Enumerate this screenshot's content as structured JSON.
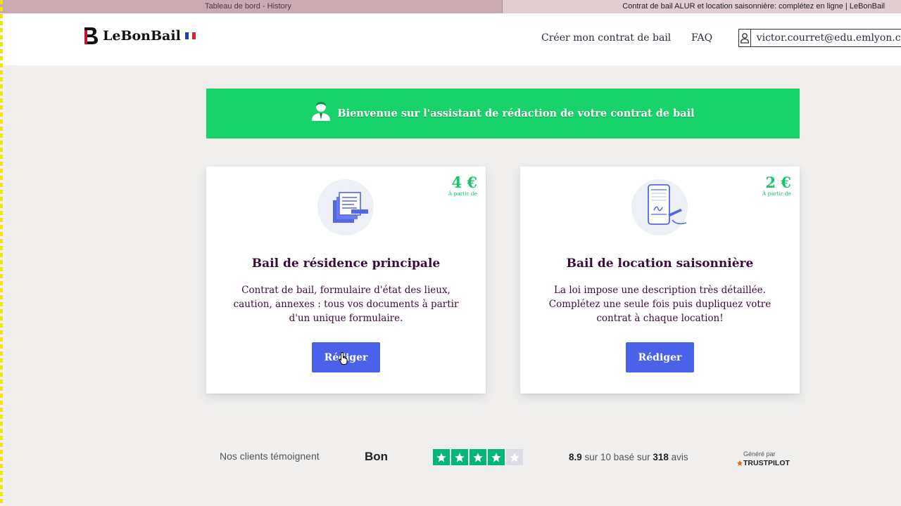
{
  "browser": {
    "tabs": [
      {
        "title": "Tableau de bord - History",
        "active": false
      },
      {
        "title": "Contrat de bail ALUR et location saisonnière: complétez en ligne | LeBonBail",
        "active": true
      }
    ]
  },
  "header": {
    "logo_text": "LeBonBail",
    "logo_mark": "B",
    "nav": {
      "create_contract": "Créer mon contrat de bail",
      "faq": "FAQ"
    },
    "account_email": "victor.courret@edu.emlyon.co"
  },
  "banner": {
    "text": "Bienvenue sur l'assistant de rédaction de votre contrat de bail",
    "icon": "user-icon"
  },
  "cards": [
    {
      "price": "4 €",
      "price_note": "À partir de",
      "icon": "documents-icon",
      "title": "Bail de résidence principale",
      "description": "Contrat de bail, formulaire d'état des lieux, caution, annexes : tous vos documents à partir d'un unique formulaire.",
      "button": "Rédiger"
    },
    {
      "price": "2 €",
      "price_note": "À partir de",
      "icon": "phone-signature-icon",
      "title": "Bail de location saisonnière",
      "description": "La loi impose une description très détaillée. Complétez une seule fois puis dupliquez votre contrat à chaque location!",
      "button": "Rédiger"
    }
  ],
  "trustpilot": {
    "clients_label": "Nos clients témoignent",
    "rating_label": "Bon",
    "stars_filled": 4,
    "stars_total": 5,
    "score": "8.9",
    "score_mid": " sur 10 basé sur ",
    "reviews": "318",
    "reviews_suffix": " avis",
    "generated_by": "Généré par",
    "brand": "TRUSTPILOT"
  },
  "colors": {
    "banner": "#17d36a",
    "button": "#4a61ea",
    "title": "#3b0c3a",
    "price": "#17c567",
    "star": "#00b67a"
  }
}
